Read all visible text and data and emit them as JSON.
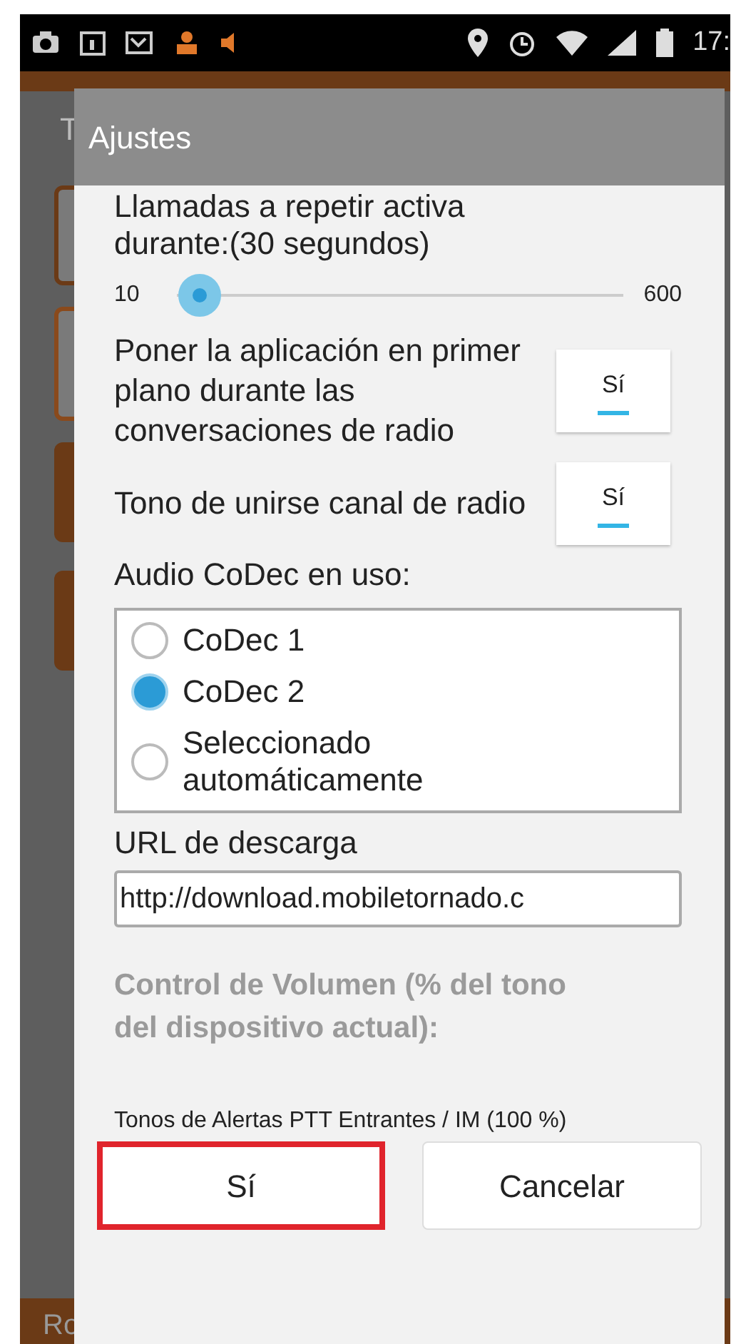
{
  "status_bar": {
    "time": "17:"
  },
  "background_app": {
    "title_fragment": "T",
    "bottom_fragment": "Ro"
  },
  "dialog": {
    "title": "Ajustes",
    "repeat_calls": {
      "label": "Llamadas a repetir activa durante:(30 segundos)",
      "min": "10",
      "max": "600",
      "level": 0.05
    },
    "toggles": [
      {
        "label": "Poner la aplicación en primer plano durante las conversaciones de radio",
        "value": "Sí",
        "on": true
      },
      {
        "label": "Tono de unirse canal de radio",
        "value": "Sí",
        "on": true
      }
    ],
    "codec": {
      "label": "Audio CoDec en uso:",
      "options": [
        {
          "label": "CoDec 1",
          "selected": false
        },
        {
          "label": "CoDec 2",
          "selected": true
        },
        {
          "label": "Seleccionado automáticamente",
          "selected": false
        }
      ]
    },
    "download_url": {
      "label": "URL de descarga",
      "value": "http://download.mobiletornado.c"
    },
    "volume_heading": {
      "text": "Control de Volumen (% del tono del dispositivo actual):",
      "disabled": true
    },
    "alert_tones": "Tonos de Alertas PTT Entrantes / IM (100 %)",
    "buttons": [
      {
        "label": "Sí",
        "highlighted": true
      },
      {
        "label": "Cancelar",
        "highlighted": false
      }
    ]
  }
}
